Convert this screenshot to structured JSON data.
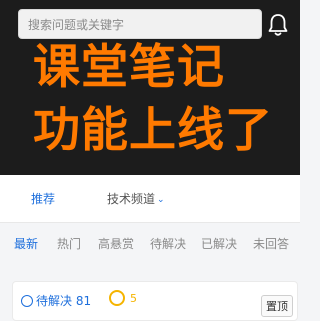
{
  "search": {
    "placeholder": "搜索问题或关键字"
  },
  "banner": {
    "line1": "课堂笔记",
    "line2": "功能上线了"
  },
  "nav": {
    "tabs": [
      {
        "label": "推荐"
      },
      {
        "label": "技术频道"
      }
    ],
    "chevron": "⌄"
  },
  "filters": [
    {
      "label": "最新"
    },
    {
      "label": "热门"
    },
    {
      "label": "高悬赏"
    },
    {
      "label": "待解决"
    },
    {
      "label": "已解决"
    },
    {
      "label": "未回答"
    }
  ],
  "card": {
    "status": "待解决",
    "count": "81",
    "coin_value": "5",
    "tag": "置顶"
  },
  "colors": {
    "accent": "#1e6fdc",
    "promo": "#ff7a00",
    "coin": "#f5b400",
    "banner_bg": "#1c1c1c"
  },
  "icons": {
    "bell": "bell-icon",
    "coin": "coin-icon",
    "status": "clock-icon"
  }
}
